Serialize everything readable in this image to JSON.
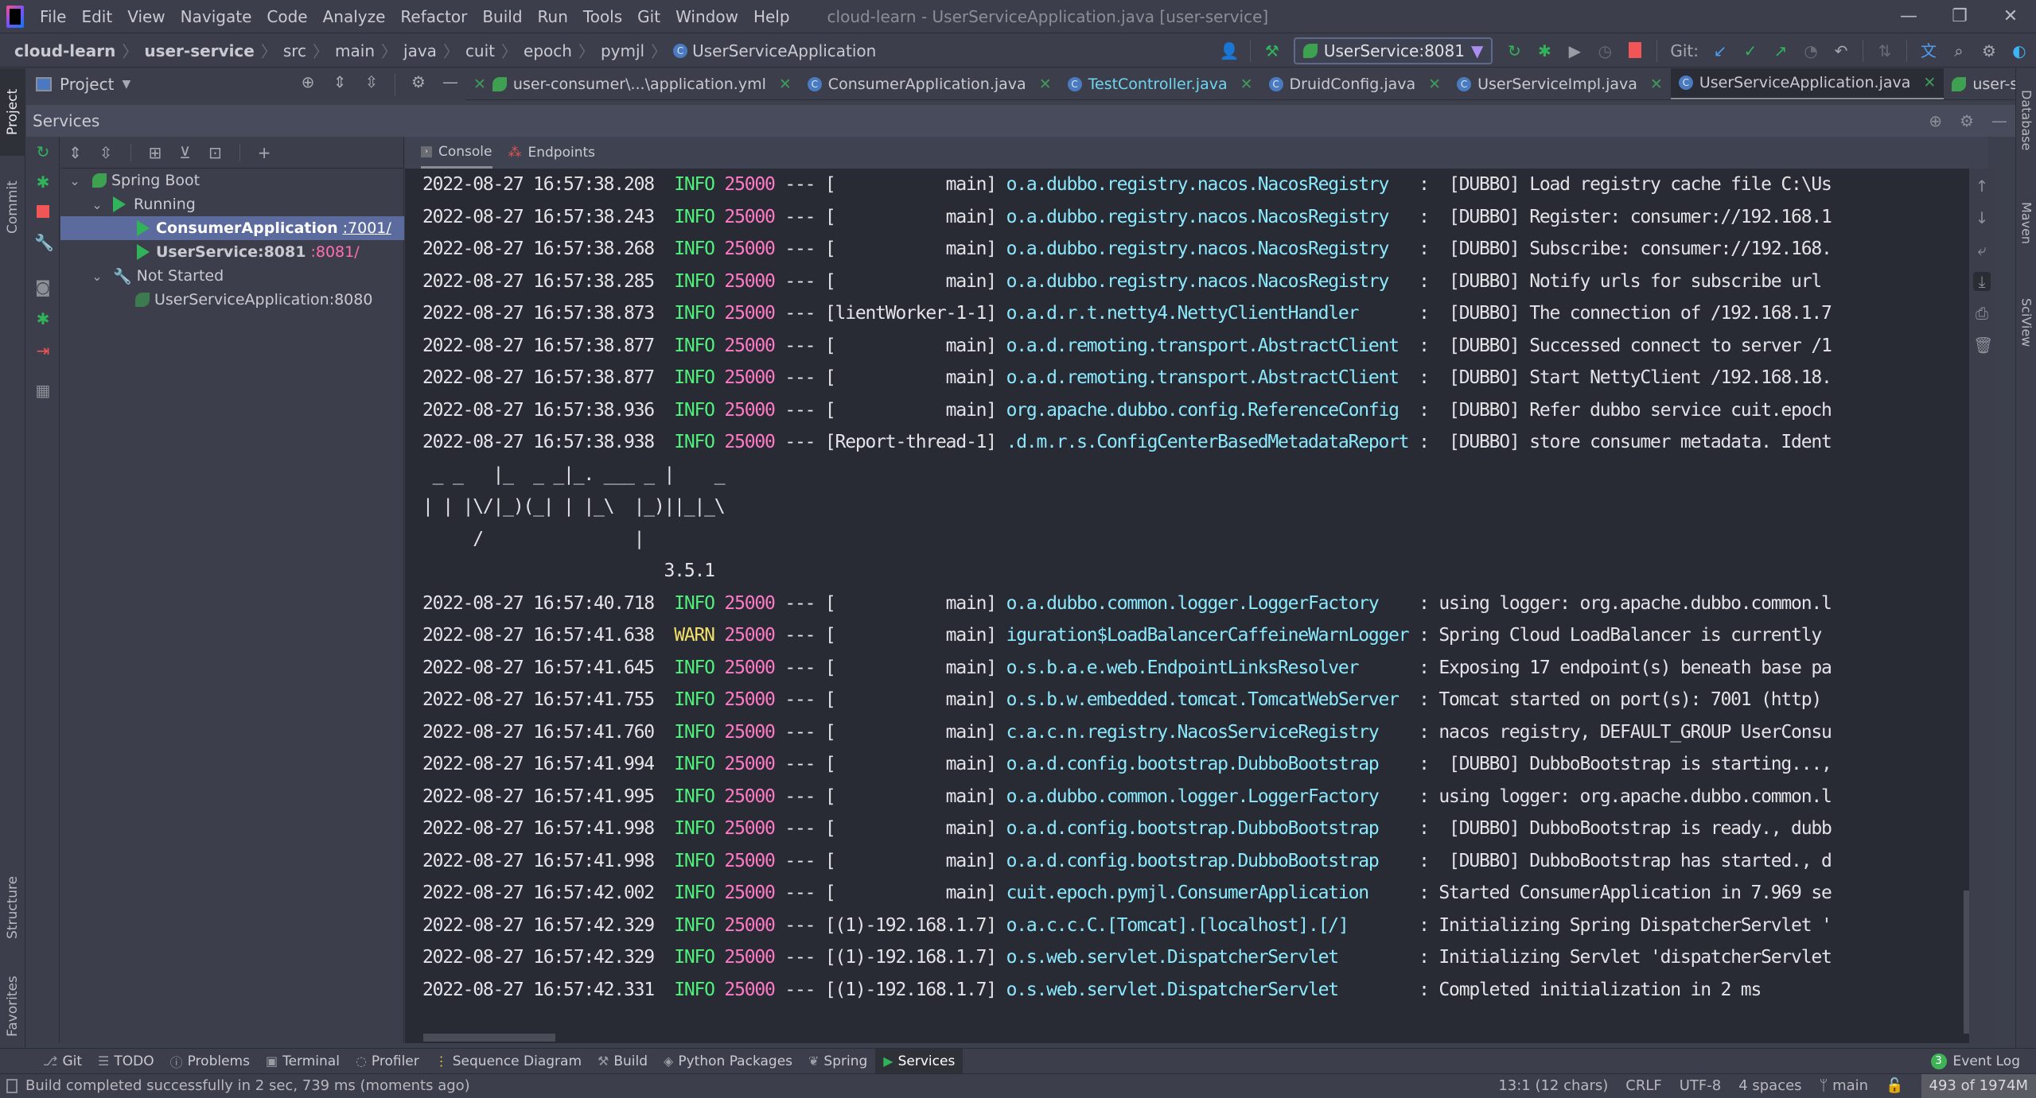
{
  "titlebar": {
    "menu": [
      "File",
      "Edit",
      "View",
      "Navigate",
      "Code",
      "Analyze",
      "Refactor",
      "Build",
      "Run",
      "Tools",
      "Git",
      "Window",
      "Help"
    ],
    "window_title": "cloud-learn - UserServiceApplication.java [user-service]",
    "controls": {
      "minimize": "—",
      "restore": "❐",
      "close": "✕"
    }
  },
  "navbar": {
    "breadcrumb": [
      "cloud-learn",
      "user-service",
      "src",
      "main",
      "java",
      "cuit",
      "epoch",
      "pymjl",
      "UserServiceApplication"
    ],
    "run_config": "UserService:8081",
    "git_label": "Git:"
  },
  "left_stripe": {
    "tabs": [
      "Project",
      "Commit",
      "Structure",
      "Favorites"
    ]
  },
  "right_stripe": {
    "tabs": [
      "Database",
      "Maven",
      "SciView"
    ]
  },
  "project_header": {
    "label": "Project"
  },
  "editor_tabs": [
    {
      "label": "user-consumer\\...\\application.yml",
      "icon": "spring-yml-icon",
      "active": false
    },
    {
      "label": "ConsumerApplication.java",
      "icon": "java-class-icon",
      "active": false
    },
    {
      "label": "TestController.java",
      "icon": "java-class-icon",
      "active": false,
      "color": "#6fd6f2"
    },
    {
      "label": "DruidConfig.java",
      "icon": "java-class-icon",
      "active": false
    },
    {
      "label": "UserServiceImpl.java",
      "icon": "java-class-icon",
      "active": false
    },
    {
      "label": "UserServiceApplication.java",
      "icon": "java-class-icon",
      "active": true
    },
    {
      "label": "user-service\\...\\a",
      "icon": "spring-yml-icon",
      "active": false
    }
  ],
  "services": {
    "title": "Services",
    "tree": {
      "root": "Spring Boot",
      "running_label": "Running",
      "running": [
        {
          "name": "ConsumerApplication",
          "port": ":7001/",
          "selected": true
        },
        {
          "name": "UserService:8081",
          "port": ":8081/",
          "selected": false
        }
      ],
      "not_started_label": "Not Started",
      "not_started": [
        {
          "name": "UserServiceApplication:8080"
        }
      ]
    }
  },
  "console": {
    "tabs": [
      "Console",
      "Endpoints"
    ],
    "lines": [
      {
        "ts": "2022-08-27 16:57:38.208",
        "level": "INFO",
        "pid": "25000",
        "thread": "[           main]",
        "logger": "o.a.dubbo.registry.nacos.NacosRegistry  ",
        "msg": " :  [DUBBO] Load registry cache file C:\\Us"
      },
      {
        "ts": "2022-08-27 16:57:38.243",
        "level": "INFO",
        "pid": "25000",
        "thread": "[           main]",
        "logger": "o.a.dubbo.registry.nacos.NacosRegistry  ",
        "msg": " :  [DUBBO] Register: consumer://192.168.1"
      },
      {
        "ts": "2022-08-27 16:57:38.268",
        "level": "INFO",
        "pid": "25000",
        "thread": "[           main]",
        "logger": "o.a.dubbo.registry.nacos.NacosRegistry  ",
        "msg": " :  [DUBBO] Subscribe: consumer://192.168."
      },
      {
        "ts": "2022-08-27 16:57:38.285",
        "level": "INFO",
        "pid": "25000",
        "thread": "[           main]",
        "logger": "o.a.dubbo.registry.nacos.NacosRegistry  ",
        "msg": " :  [DUBBO] Notify urls for subscribe url"
      },
      {
        "ts": "2022-08-27 16:57:38.873",
        "level": "INFO",
        "pid": "25000",
        "thread": "[lientWorker-1-1]",
        "logger": "o.a.d.r.t.netty4.NettyClientHandler     ",
        "msg": " :  [DUBBO] The connection of /192.168.1.7"
      },
      {
        "ts": "2022-08-27 16:57:38.877",
        "level": "INFO",
        "pid": "25000",
        "thread": "[           main]",
        "logger": "o.a.d.remoting.transport.AbstractClient ",
        "msg": " :  [DUBBO] Successed connect to server /1"
      },
      {
        "ts": "2022-08-27 16:57:38.877",
        "level": "INFO",
        "pid": "25000",
        "thread": "[           main]",
        "logger": "o.a.d.remoting.transport.AbstractClient ",
        "msg": " :  [DUBBO] Start NettyClient /192.168.18."
      },
      {
        "ts": "2022-08-27 16:57:38.936",
        "level": "INFO",
        "pid": "25000",
        "thread": "[           main]",
        "logger": "org.apache.dubbo.config.ReferenceConfig ",
        "msg": " :  [DUBBO] Refer dubbo service cuit.epoch"
      },
      {
        "ts": "2022-08-27 16:57:38.938",
        "level": "INFO",
        "pid": "25000",
        "thread": "[Report-thread-1]",
        "logger": ".d.m.r.s.ConfigCenterBasedMetadataReport",
        "msg": " :  [DUBBO] store consumer metadata. Ident"
      }
    ],
    "banner": [
      " _ _   |_  _ _|_. ___ _ |    _",
      "| | |\\/|_)(_| | |_\\  |_)||_|_\\",
      "     /               |",
      "                        3.5.1"
    ],
    "lines2": [
      {
        "ts": "2022-08-27 16:57:40.718",
        "level": "INFO",
        "pid": "25000",
        "thread": "[           main]",
        "logger": "o.a.dubbo.common.logger.LoggerFactory   ",
        "msg": " : using logger: org.apache.dubbo.common.l"
      },
      {
        "ts": "2022-08-27 16:57:41.638",
        "level": "WARN",
        "pid": "25000",
        "thread": "[           main]",
        "logger": "iguration$LoadBalancerCaffeineWarnLogger",
        "msg": " : Spring Cloud LoadBalancer is currently"
      },
      {
        "ts": "2022-08-27 16:57:41.645",
        "level": "INFO",
        "pid": "25000",
        "thread": "[           main]",
        "logger": "o.s.b.a.e.web.EndpointLinksResolver     ",
        "msg": " : Exposing 17 endpoint(s) beneath base pa"
      },
      {
        "ts": "2022-08-27 16:57:41.755",
        "level": "INFO",
        "pid": "25000",
        "thread": "[           main]",
        "logger": "o.s.b.w.embedded.tomcat.TomcatWebServer ",
        "msg": " : Tomcat started on port(s): 7001 (http)"
      },
      {
        "ts": "2022-08-27 16:57:41.760",
        "level": "INFO",
        "pid": "25000",
        "thread": "[           main]",
        "logger": "c.a.c.n.registry.NacosServiceRegistry   ",
        "msg": " : nacos registry, DEFAULT_GROUP UserConsu"
      },
      {
        "ts": "2022-08-27 16:57:41.994",
        "level": "INFO",
        "pid": "25000",
        "thread": "[           main]",
        "logger": "o.a.d.config.bootstrap.DubboBootstrap   ",
        "msg": " :  [DUBBO] DubboBootstrap is starting...,"
      },
      {
        "ts": "2022-08-27 16:57:41.995",
        "level": "INFO",
        "pid": "25000",
        "thread": "[           main]",
        "logger": "o.a.dubbo.common.logger.LoggerFactory   ",
        "msg": " : using logger: org.apache.dubbo.common.l"
      },
      {
        "ts": "2022-08-27 16:57:41.998",
        "level": "INFO",
        "pid": "25000",
        "thread": "[           main]",
        "logger": "o.a.d.config.bootstrap.DubboBootstrap   ",
        "msg": " :  [DUBBO] DubboBootstrap is ready., dubb"
      },
      {
        "ts": "2022-08-27 16:57:41.998",
        "level": "INFO",
        "pid": "25000",
        "thread": "[           main]",
        "logger": "o.a.d.config.bootstrap.DubboBootstrap   ",
        "msg": " :  [DUBBO] DubboBootstrap has started., d"
      },
      {
        "ts": "2022-08-27 16:57:42.002",
        "level": "INFO",
        "pid": "25000",
        "thread": "[           main]",
        "logger": "cuit.epoch.pymjl.ConsumerApplication    ",
        "msg": " : Started ConsumerApplication in 7.969 se"
      },
      {
        "ts": "2022-08-27 16:57:42.329",
        "level": "INFO",
        "pid": "25000",
        "thread": "[(1)-192.168.1.7]",
        "logger": "o.a.c.c.C.[Tomcat].[localhost].[/]      ",
        "msg": " : Initializing Spring DispatcherServlet '"
      },
      {
        "ts": "2022-08-27 16:57:42.329",
        "level": "INFO",
        "pid": "25000",
        "thread": "[(1)-192.168.1.7]",
        "logger": "o.s.web.servlet.DispatcherServlet       ",
        "msg": " : Initializing Servlet 'dispatcherServlet"
      },
      {
        "ts": "2022-08-27 16:57:42.331",
        "level": "INFO",
        "pid": "25000",
        "thread": "[(1)-192.168.1.7]",
        "logger": "o.s.web.servlet.DispatcherServlet       ",
        "msg": " : Completed initialization in 2 ms"
      }
    ]
  },
  "bottom_tabs": [
    "Git",
    "TODO",
    "Problems",
    "Terminal",
    "Profiler",
    "Sequence Diagram",
    "Build",
    "Python Packages",
    "Spring",
    "Services"
  ],
  "bottom_active": "Services",
  "event_log": {
    "label": "Event Log",
    "count": "3"
  },
  "statusbar": {
    "message": "Build completed successfully in 2 sec, 739 ms (moments ago)",
    "position": "13:1 (12 chars)",
    "line_sep": "CRLF",
    "encoding": "UTF-8",
    "indent": "4 spaces",
    "branch": "main",
    "memory": "493 of 1974M"
  },
  "colors": {
    "info": "#4ef27a",
    "warn": "#f2e06a",
    "pid": "#ff79c6",
    "logger": "#8be9fd",
    "selection": "#5c6b9e",
    "console_bg": "#282a34"
  }
}
